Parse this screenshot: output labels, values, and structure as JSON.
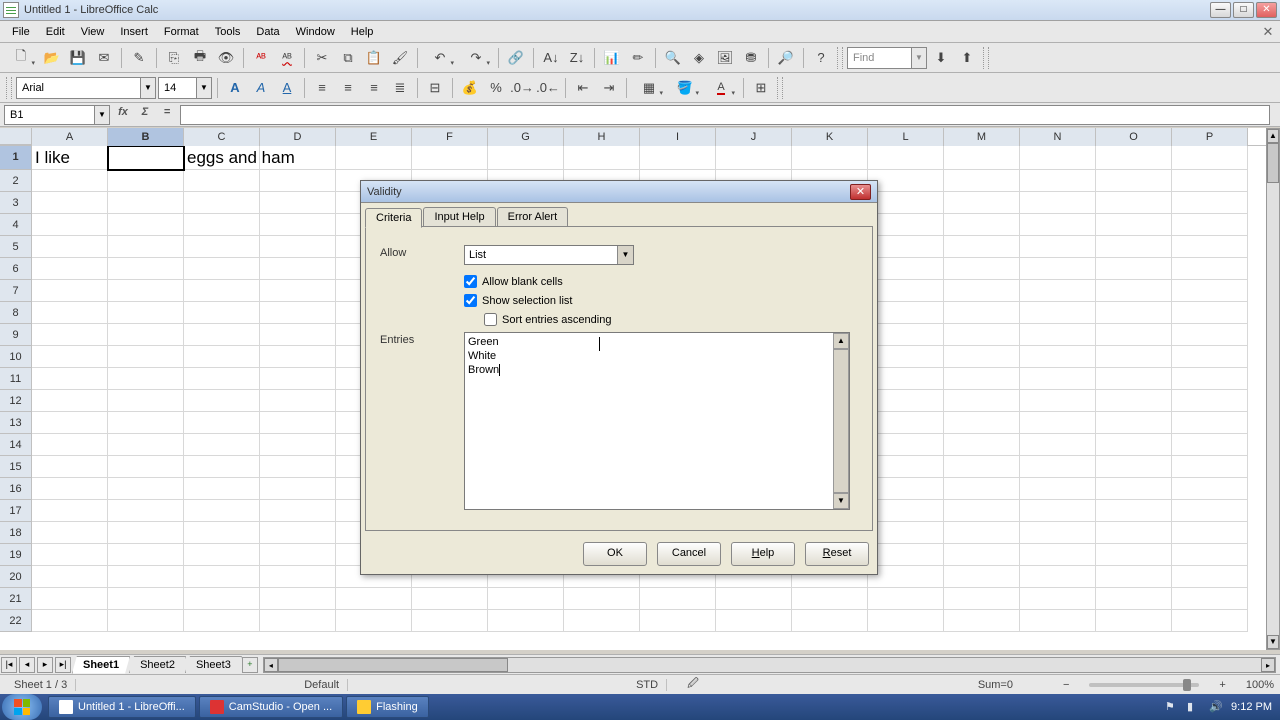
{
  "window": {
    "title": "Untitled 1 - LibreOffice Calc"
  },
  "menubar": {
    "items": [
      "File",
      "Edit",
      "View",
      "Insert",
      "Format",
      "Tools",
      "Data",
      "Window",
      "Help"
    ]
  },
  "find": {
    "placeholder": "Find"
  },
  "format": {
    "font": "Arial",
    "size": "14"
  },
  "namebox": {
    "ref": "B1"
  },
  "columns": [
    "A",
    "B",
    "C",
    "D",
    "E",
    "F",
    "G",
    "H",
    "I",
    "J",
    "K",
    "L",
    "M",
    "N",
    "O",
    "P"
  ],
  "cells": {
    "A1": "I like",
    "C1": "eggs and ham"
  },
  "sheets": {
    "tabs": [
      "Sheet1",
      "Sheet2",
      "Sheet3"
    ],
    "active": 0
  },
  "status": {
    "sheet": "Sheet 1 / 3",
    "style": "Default",
    "mode": "STD",
    "sum": "Sum=0",
    "zoom": "100%"
  },
  "dialog": {
    "title": "Validity",
    "tabs": [
      "Criteria",
      "Input Help",
      "Error Alert"
    ],
    "allow_label": "Allow",
    "allow_value": "List",
    "allow_blank": {
      "label": "Allow blank cells",
      "checked": true
    },
    "show_list": {
      "label": "Show selection list",
      "checked": true
    },
    "sort_asc": {
      "label": "Sort entries ascending",
      "checked": false
    },
    "entries_label": "Entries",
    "entries_text": "Green\nWhite\nBrown",
    "buttons": {
      "ok": "OK",
      "cancel": "Cancel",
      "help": "Help",
      "reset": "Reset"
    }
  },
  "taskbar": {
    "items": [
      "Untitled 1 - LibreOffi...",
      "CamStudio - Open ...",
      "Flashing"
    ],
    "time": "9:12 PM"
  }
}
